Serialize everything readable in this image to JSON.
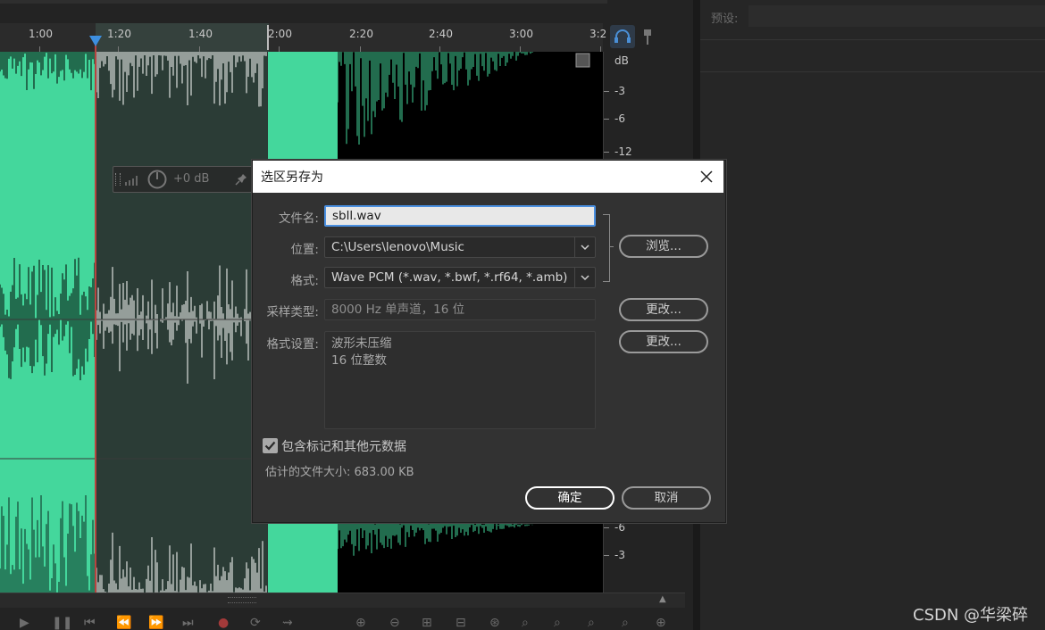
{
  "timeline": {
    "ticks": [
      "1:00",
      "1:20",
      "1:40",
      "2:00",
      "2:20",
      "2:40",
      "3:00",
      "3:2"
    ]
  },
  "db_ruler": {
    "unit": "dB",
    "top_labels": [
      "-3",
      "-6",
      "-12"
    ],
    "bottom_labels": [
      "-6",
      "-3"
    ]
  },
  "hud": {
    "gain": "+0 dB"
  },
  "right_panel": {
    "preset_label": "预设:"
  },
  "dialog": {
    "title": "选区另存为",
    "filename_label": "文件名:",
    "filename_value": "sbll.wav",
    "location_label": "位置:",
    "location_value": "C:\\Users\\lenovo\\Music",
    "format_label": "格式:",
    "format_value": "Wave PCM (*.wav, *.bwf, *.rf64, *.amb)",
    "browse_button": "浏览...",
    "sample_type_label": "采样类型:",
    "sample_type_value": "8000 Hz 单声道，16 位",
    "change_button_1": "更改...",
    "format_settings_label": "格式设置:",
    "format_settings_lines": [
      "波形未压缩",
      "16 位整数"
    ],
    "change_button_2": "更改...",
    "include_markers_label": "包含标记和其他元数据",
    "include_markers_checked": true,
    "estimated_size": "估计的文件大小: 683.00 KB",
    "ok_button": "确定",
    "cancel_button": "取消"
  },
  "colors": {
    "waveform": "#44d79c",
    "waveform_selected": "#ffffff",
    "selection_bg": "#2b3c36",
    "background": "#232323"
  },
  "watermark": "CSDN @华梁碎"
}
